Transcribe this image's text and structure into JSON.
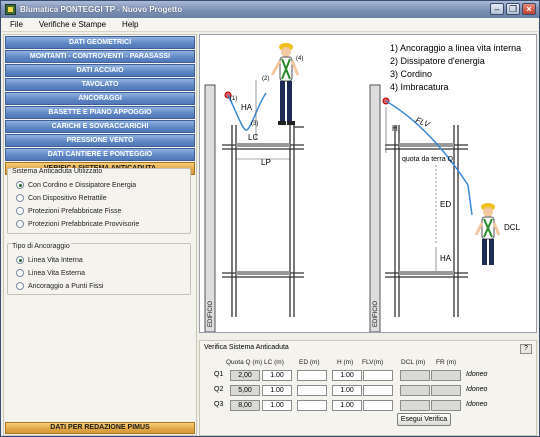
{
  "window": {
    "title": "Blumatica PONTEGGI TP - Nuovo Progetto"
  },
  "menu": [
    "File",
    "Verifiche e Stampe",
    "Help"
  ],
  "nav": {
    "items": [
      "DATI GEOMETRICI",
      "MONTANTI - CONTROVENTI - PARASASSI",
      "DATI ACCIAIO",
      "TAVOLATO",
      "ANCORAGGI",
      "BASETTE E PIANO APPOGGIO",
      "CARICHI E SOVRACCARICHI",
      "PRESSIONE VENTO",
      "DATI CANTIERE E PONTEGGIO",
      "VERIFICA SISTEMA ANTICADUTA"
    ],
    "active_index": 9,
    "bottom_button": "DATI PER REDAZIONE PIMUS"
  },
  "sistema": {
    "title": "Sistema Anticaduta Utilizzato",
    "options": [
      "Con Cordino e Dissipatore Energia",
      "Con Dispositivo Retrattile",
      "Protezioni Prefabbricate Fisse",
      "Protezioni Prefabbricate Provvisorie"
    ],
    "selected": 0
  },
  "ancoraggio": {
    "title": "Tipo di Ancoraggio",
    "options": [
      "Linea Vita Interna",
      "Linea Vita Esterna",
      "Ancoraggio a Punti Fissi"
    ],
    "selected": 0
  },
  "diagram": {
    "legend": [
      "1) Ancoraggio a linea vita interna",
      "2) Dissipatore d'energia",
      "3) Cordino",
      "4) Imbracatura"
    ],
    "labels": {
      "ha": "HA",
      "lc": "LC",
      "lp": "LP",
      "h": "H",
      "flv": "FLV",
      "quota": "quota da terra Q",
      "ed": "ED",
      "dcl": "DCL",
      "ha2": "HA",
      "edificio": "EDIFICIO",
      "edificio2": "EDIFICIO",
      "n1": "(1)",
      "n2": "(2)",
      "n3": "(3)",
      "n4": "(4)"
    }
  },
  "verifica": {
    "title": "Verifica Sistema Anticaduta",
    "help": "?",
    "headers": [
      "Quota Q (m)",
      "LC (m)",
      "ED (m)",
      "H (m)",
      "FLV(m)",
      "DCL (m)",
      "FR (m)"
    ],
    "rows": [
      {
        "label": "Q1",
        "quota": "2,00",
        "lc": "1.00",
        "ed": "",
        "h": "1.00",
        "flv": "",
        "dcl": "",
        "fr": "",
        "esito": "Idoneo"
      },
      {
        "label": "Q2",
        "quota": "5,00",
        "lc": "1.00",
        "ed": "",
        "h": "1.00",
        "flv": "",
        "dcl": "",
        "fr": "",
        "esito": "Idoneo"
      },
      {
        "label": "Q3",
        "quota": "8,00",
        "lc": "1.00",
        "ed": "",
        "h": "1.00",
        "flv": "",
        "dcl": "",
        "fr": "",
        "esito": "Idoneo"
      }
    ],
    "button": "Esegui Verifica"
  }
}
